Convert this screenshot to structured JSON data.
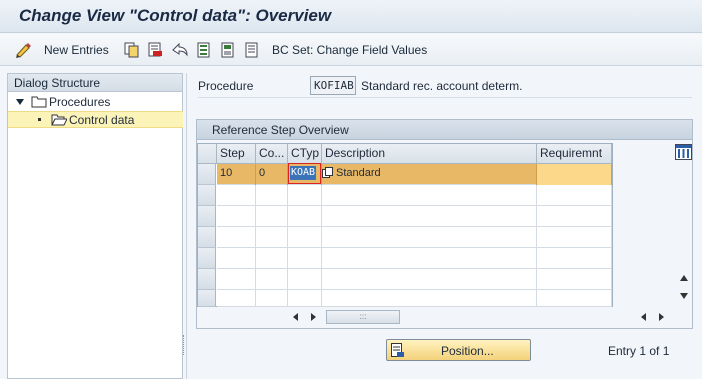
{
  "window": {
    "title": "Change View \"Control data\": Overview"
  },
  "toolbar": {
    "new_entries_label": "New Entries",
    "bc_set_label": "BC Set: Change Field Values"
  },
  "dialog_structure": {
    "header": "Dialog Structure",
    "items": [
      {
        "label": "Procedures"
      },
      {
        "label": "Control data"
      }
    ]
  },
  "procedure": {
    "label": "Procedure",
    "value": "KOFIAB",
    "description": "Standard rec. account determ."
  },
  "reference_steps": {
    "header": "Reference Step Overview",
    "columns": [
      "Step",
      "Co...",
      "CTyp",
      "Description",
      "Requiremnt"
    ],
    "rows": [
      {
        "step": "10",
        "counter": "0",
        "ctyp": "KOAB",
        "description": "Standard",
        "requirement": ""
      }
    ]
  },
  "footer": {
    "position_label": "Position...",
    "entry_text": "Entry 1 of 1"
  },
  "colors": {
    "highlight_row": "#e9b866",
    "selection": "#fbf3b8",
    "focus_field": "#3b73b9"
  }
}
